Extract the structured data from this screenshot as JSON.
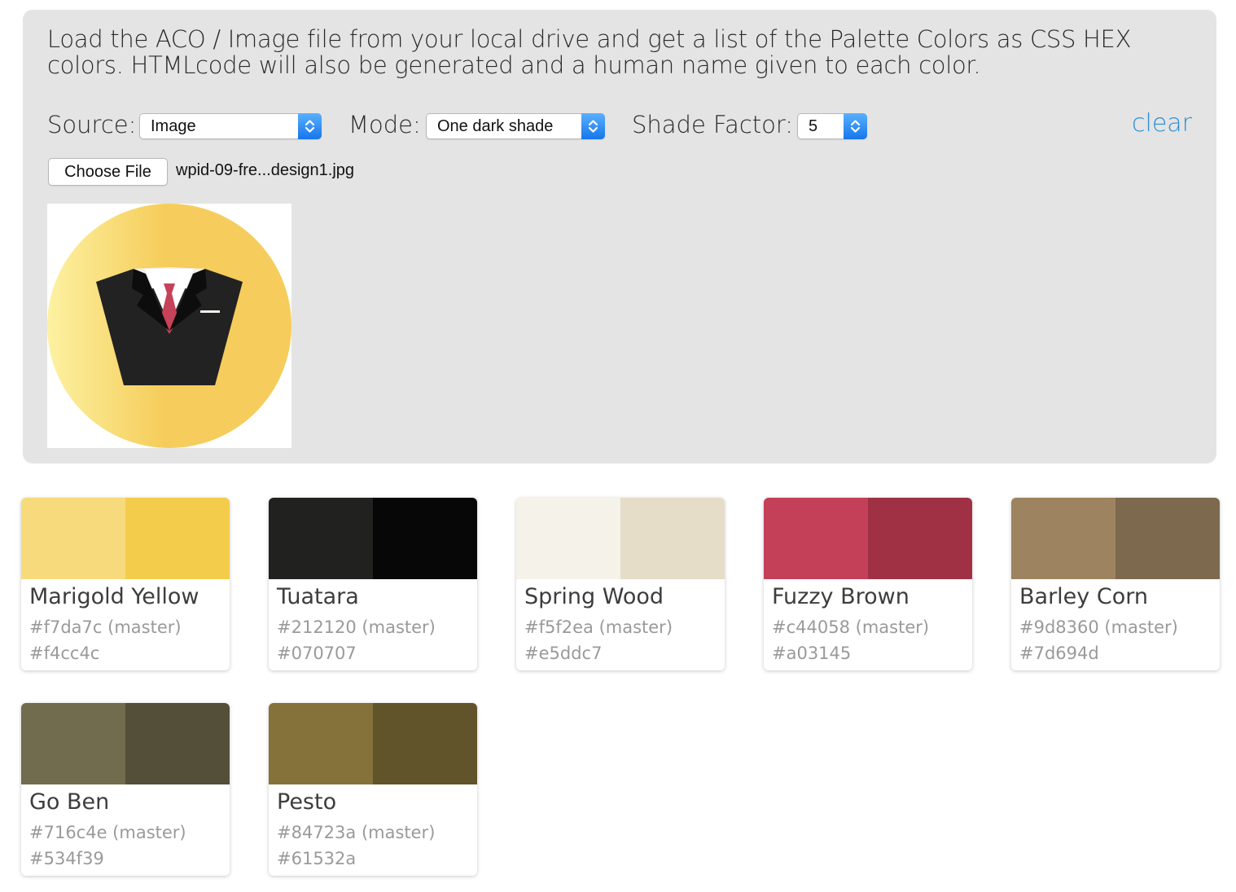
{
  "intro_text": "Load the ACO / Image file from your local drive and get a list of the Palette Colors as CSS HEX colors. HTMLcode will also be generated and a human name given to each color.",
  "controls": {
    "source_label": "Source:",
    "source_value": "Image",
    "mode_label": "Mode:",
    "mode_value": "One dark shade",
    "shade_label": "Shade Factor:",
    "shade_value": "5",
    "clear_label": "clear",
    "choose_file_label": "Choose File",
    "file_name": "wpid-09-fre...design1.jpg"
  },
  "colors": {
    "accent": "#2a8fd6",
    "panel_bg": "#e4e4e4"
  },
  "preview_icon": "suit-and-tie-icon",
  "palette": [
    {
      "name": "Marigold Yellow",
      "master": "#f7da7c",
      "master_label": "#f7da7c (master)",
      "shade": "#f4cc4c",
      "shade_label": "#f4cc4c"
    },
    {
      "name": "Tuatara",
      "master": "#212120",
      "master_label": "#212120 (master)",
      "shade": "#070707",
      "shade_label": "#070707"
    },
    {
      "name": "Spring Wood",
      "master": "#f5f2ea",
      "master_label": "#f5f2ea (master)",
      "shade": "#e5ddc7",
      "shade_label": "#e5ddc7"
    },
    {
      "name": "Fuzzy Brown",
      "master": "#c44058",
      "master_label": "#c44058 (master)",
      "shade": "#a03145",
      "shade_label": "#a03145"
    },
    {
      "name": "Barley Corn",
      "master": "#9d8360",
      "master_label": "#9d8360 (master)",
      "shade": "#7d694d",
      "shade_label": "#7d694d"
    },
    {
      "name": "Go Ben",
      "master": "#716c4e",
      "master_label": "#716c4e (master)",
      "shade": "#534f39",
      "shade_label": "#534f39"
    },
    {
      "name": "Pesto",
      "master": "#84723a",
      "master_label": "#84723a (master)",
      "shade": "#61532a",
      "shade_label": "#61532a"
    }
  ]
}
